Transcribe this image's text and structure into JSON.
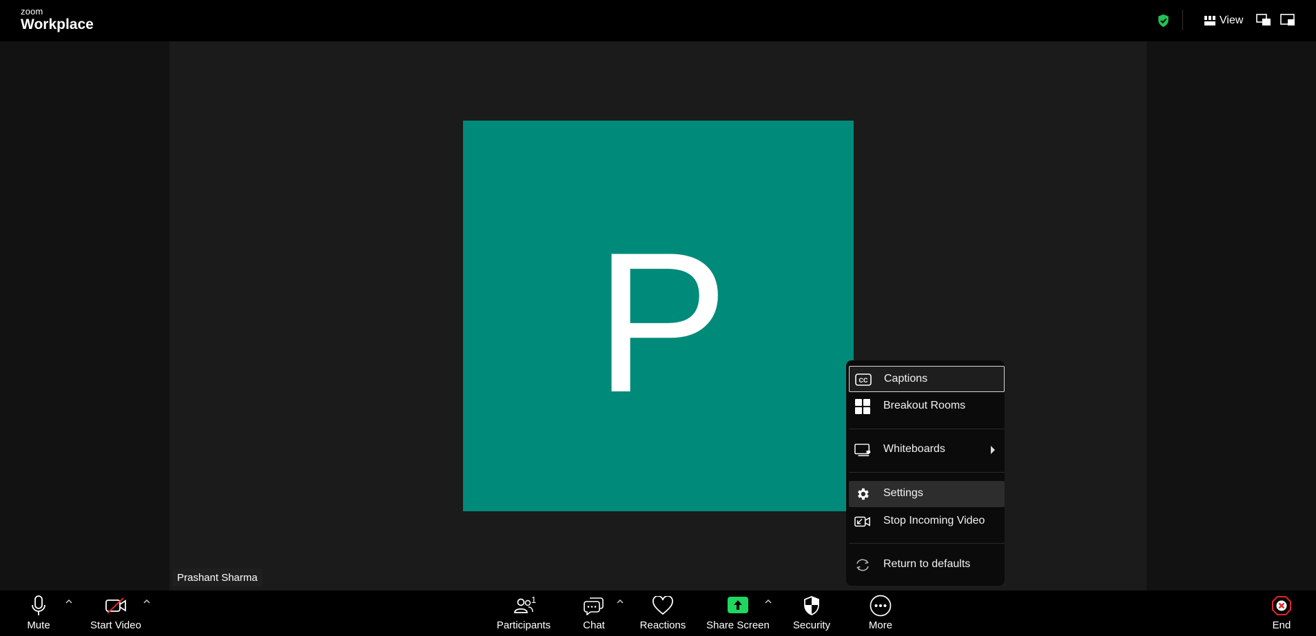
{
  "app": {
    "brand_small": "zoom",
    "brand_large": "Workplace"
  },
  "topbar": {
    "view_label": "View"
  },
  "participant": {
    "initial": "P",
    "name": "Prashant Sharma",
    "avatar_color": "#008a7a"
  },
  "more_menu": {
    "items": [
      {
        "label": "Captions",
        "icon": "captions-icon"
      },
      {
        "label": "Breakout Rooms",
        "icon": "breakout-rooms-icon"
      },
      {
        "label": "Whiteboards",
        "icon": "whiteboard-icon"
      },
      {
        "label": "Settings",
        "icon": "gear-icon"
      },
      {
        "label": "Stop Incoming Video",
        "icon": "stop-video-icon"
      },
      {
        "label": "Return to defaults",
        "icon": "refresh-icon"
      }
    ]
  },
  "toolbar": {
    "mute": "Mute",
    "start_video": "Start Video",
    "participants": "Participants",
    "participants_count": "1",
    "chat": "Chat",
    "reactions": "Reactions",
    "share_screen": "Share Screen",
    "security": "Security",
    "more": "More",
    "end": "End"
  },
  "colors": {
    "share_green": "#1ed760",
    "secure_green": "#21c354",
    "end_red": "#e02828",
    "video_off_red": "#e02828"
  }
}
